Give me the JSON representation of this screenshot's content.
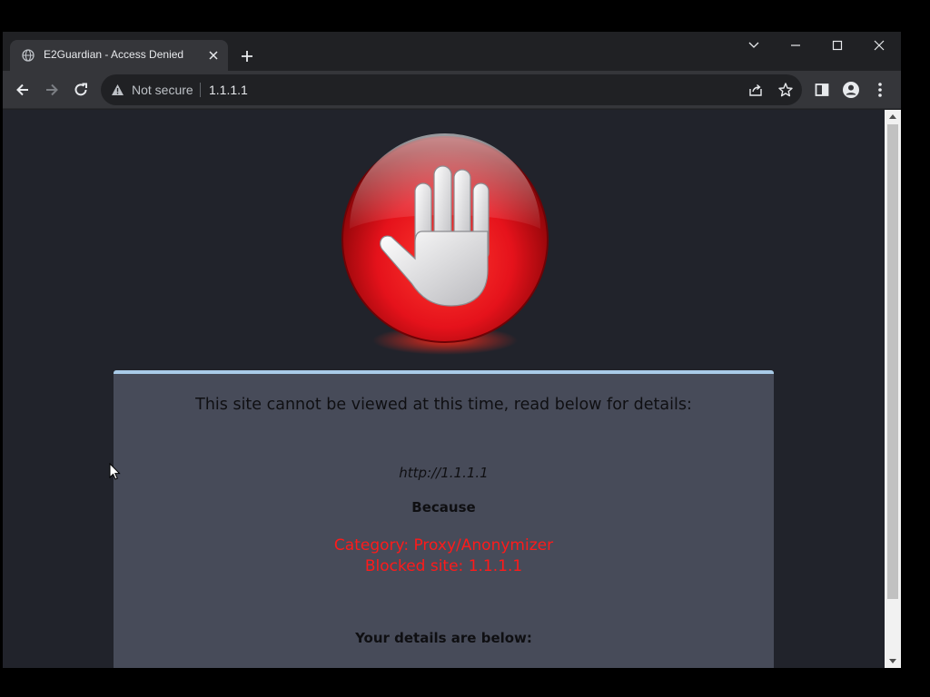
{
  "browser": {
    "tab": {
      "title": "E2Guardian - Access Denied"
    },
    "toolbar": {
      "security_label": "Not secure",
      "url": "1.1.1.1"
    }
  },
  "page": {
    "headline": "This site cannot be viewed at this time, read below for details:",
    "blocked_url": "http://1.1.1.1",
    "because_label": "Because",
    "reason_category": "Category: Proxy/Anonymizer",
    "reason_blocked": "Blocked site: 1.1.1.1",
    "details_label": "Your details are below:"
  },
  "colors": {
    "accent_border": "#a9cbe8",
    "panel_bg": "#474b59",
    "page_bg": "#21232b",
    "reason_text": "#ff1a1a"
  },
  "icons": [
    "globe-icon",
    "close-icon",
    "plus-icon",
    "chevron-down-icon",
    "minimize-icon",
    "maximize-icon",
    "window-close-icon",
    "back-icon",
    "forward-icon",
    "reload-icon",
    "warning-icon",
    "share-icon",
    "star-icon",
    "side-panel-icon",
    "profile-icon",
    "more-icon",
    "stop-hand-icon",
    "cursor-icon"
  ]
}
